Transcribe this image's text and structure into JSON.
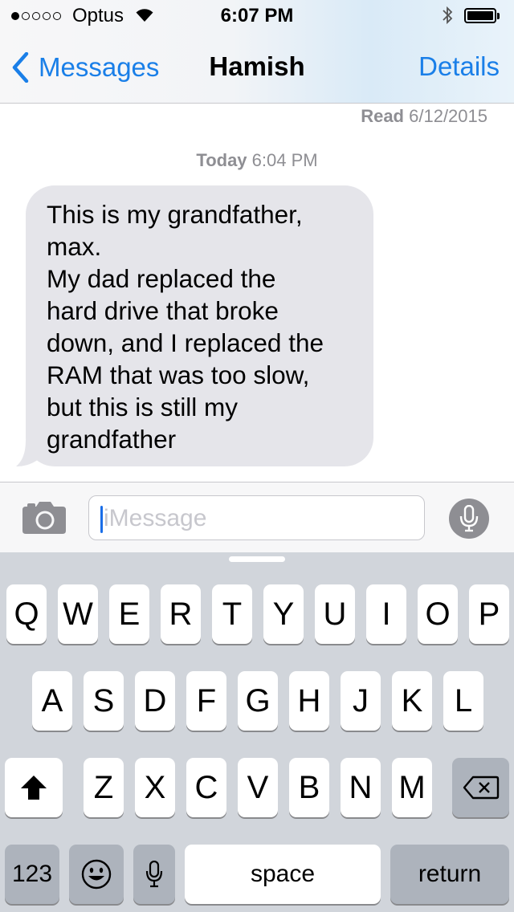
{
  "status_bar": {
    "carrier": "Optus",
    "time": "6:07 PM",
    "signal_bars": 1,
    "signal_total": 5
  },
  "nav": {
    "back_label": "Messages",
    "title": "Hamish",
    "details_label": "Details"
  },
  "conversation": {
    "read_receipt_bold": "Read",
    "read_receipt_date": "6/12/2015",
    "timestamp_day": "Today",
    "timestamp_time": "6:04 PM",
    "messages": [
      {
        "direction": "incoming",
        "text": "This is my grandfather,\nmax.\nMy dad replaced the\nhard drive that broke\ndown, and I replaced the\nRAM that was too slow,\nbut this is still my\ngrandfather"
      }
    ]
  },
  "composer": {
    "placeholder": "iMessage"
  },
  "keyboard": {
    "row1": [
      "Q",
      "W",
      "E",
      "R",
      "T",
      "Y",
      "U",
      "I",
      "O",
      "P"
    ],
    "row2": [
      "A",
      "S",
      "D",
      "F",
      "G",
      "H",
      "J",
      "K",
      "L"
    ],
    "row3": [
      "Z",
      "X",
      "C",
      "V",
      "B",
      "N",
      "M"
    ],
    "numbers_label": "123",
    "space_label": "space",
    "return_label": "return"
  },
  "colors": {
    "accent": "#1a7fe8",
    "incoming_bubble": "#e5e5ea",
    "keyboard_bg": "#d1d5db"
  }
}
